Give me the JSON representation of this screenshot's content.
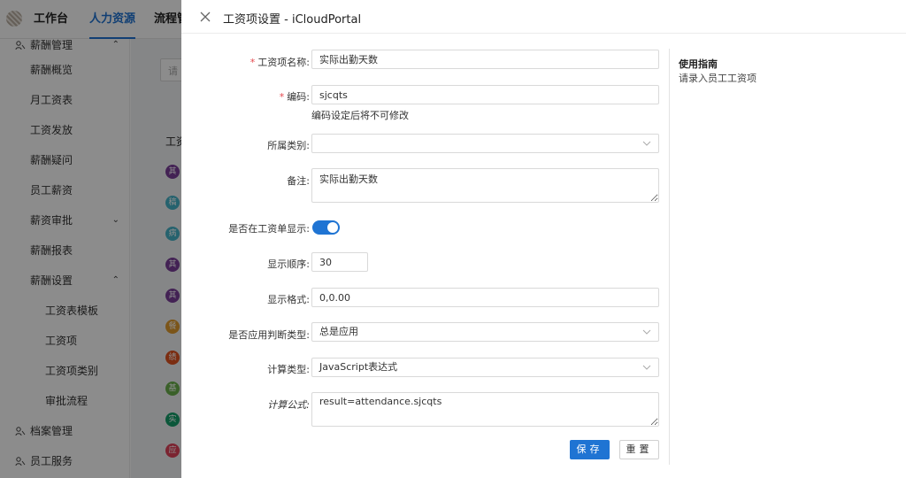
{
  "app": {
    "top_nav": [
      "工作台",
      "人力资源",
      "流程管"
    ],
    "top_nav_active": 1,
    "sidebar": {
      "sections": [
        {
          "label": "薪酬管理",
          "icon": "people-icon",
          "expanded": true
        },
        {
          "label": "档案管理",
          "icon": "people-icon"
        },
        {
          "label": "员工服务",
          "icon": "people-icon"
        }
      ],
      "items": [
        "薪酬概览",
        "月工资表",
        "工资发放",
        "薪酬疑问",
        "员工薪资",
        "薪资审批",
        "薪酬报表",
        "薪酬设置"
      ],
      "sub_items": [
        "工资表模板",
        "工资项",
        "工资项类别",
        "审批流程"
      ]
    },
    "background": {
      "search_placeholder": "请",
      "column_header": "工资",
      "row_avatars": [
        {
          "char": "其",
          "color": "#7a3f9a"
        },
        {
          "char": "稿",
          "color": "#45b3c8"
        },
        {
          "char": "病",
          "color": "#45b3c8"
        },
        {
          "char": "其",
          "color": "#7a3f9a"
        },
        {
          "char": "其",
          "color": "#7a3f9a"
        },
        {
          "char": "餐",
          "color": "#e19b2e"
        },
        {
          "char": "绩",
          "color": "#e0531f"
        },
        {
          "char": "基",
          "color": "#6ab04c"
        },
        {
          "char": "实",
          "color": "#159e6a"
        },
        {
          "char": "应",
          "color": "#e0425a"
        }
      ]
    }
  },
  "drawer": {
    "title": "工资项设置 - iCloudPortal",
    "form": {
      "name": {
        "label": "工资项名称:",
        "required": true,
        "value": "实际出勤天数"
      },
      "code": {
        "label": "编码:",
        "required": true,
        "value": "sjcqts",
        "hint": "编码设定后将不可修改"
      },
      "category": {
        "label": "所属类别:",
        "value": ""
      },
      "remark": {
        "label": "备注:",
        "value": "实际出勤天数"
      },
      "show_on_payslip": {
        "label": "是否在工资单显示:",
        "checked": true
      },
      "order": {
        "label": "显示顺序:",
        "value": "30"
      },
      "format": {
        "label": "显示格式:",
        "value": "0,0.00"
      },
      "apply_type": {
        "label": "是否应用判断类型:",
        "value": "总是应用"
      },
      "calc_type": {
        "label": "计算类型:",
        "value": "JavaScript表达式"
      },
      "formula": {
        "label": "计算公式:",
        "value": "result=attendance.sjcqts"
      }
    },
    "buttons": {
      "save": "保存",
      "reset": "重置"
    },
    "guide": {
      "title": "使用指南",
      "text": "请录入员工工资项"
    }
  },
  "colors": {
    "accent": "#1f74d3",
    "required": "#e5484d"
  }
}
